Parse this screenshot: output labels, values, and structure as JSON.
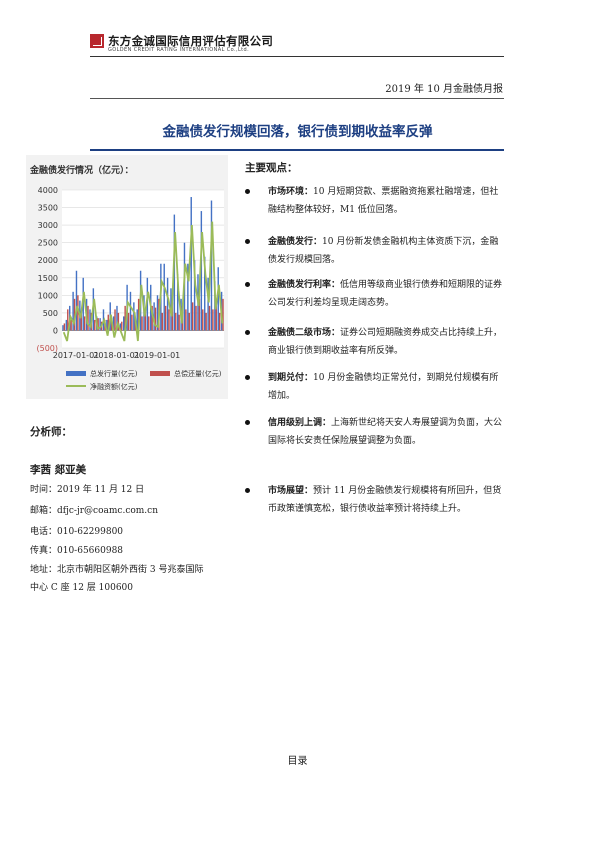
{
  "header": {
    "company_cn": "东方金诚国际信用评估有限公司",
    "company_en": "GOLDEN CREDIT RATING INTERNATIONAL Co.,Ltd.",
    "report_name": "2019 年 10 月金融债月报"
  },
  "title": "金融债发行规模回落，银行债到期收益率反弹",
  "chart_box": {
    "title": "金融债发行情况（亿元）：",
    "chart_data": {
      "type": "bar",
      "ylim": [
        -500,
        4000
      ],
      "yticks": [
        "4000",
        "3500",
        "3000",
        "2500",
        "2000",
        "1500",
        "1000",
        "500",
        "0",
        "(500)"
      ],
      "xticks": [
        "2017-01-01",
        "2018-01-01",
        "2019-01-01"
      ],
      "series": [
        {
          "name": "总发行量(亿元)",
          "type": "bar",
          "color": "#4472c4",
          "values": [
            150,
            300,
            700,
            1100,
            1700,
            850,
            1500,
            900,
            600,
            1200,
            400,
            350,
            600,
            300,
            800,
            400,
            700,
            200,
            400,
            1300,
            1100,
            800,
            600,
            1700,
            1000,
            1500,
            1300,
            800,
            1000,
            1900,
            1900,
            1500,
            1200,
            3300,
            1600,
            900,
            2500,
            1900,
            3800,
            2000,
            1600,
            3400,
            2100,
            1500,
            3700,
            1400,
            1800,
            1100
          ]
        },
        {
          "name": "总偿还量(亿元)",
          "type": "bar",
          "color": "#c0504d",
          "values": [
            200,
            600,
            300,
            900,
            1000,
            500,
            400,
            700,
            500,
            300,
            350,
            250,
            300,
            450,
            350,
            600,
            500,
            250,
            700,
            500,
            450,
            300,
            900,
            400,
            600,
            400,
            700,
            650,
            900,
            500,
            700,
            600,
            800,
            500,
            450,
            700,
            600,
            500,
            800,
            700,
            900,
            600,
            500,
            700,
            600,
            800,
            500,
            900
          ]
        },
        {
          "name": "净融资额(亿元)",
          "type": "line",
          "color": "#9bbb59",
          "values": [
            -50,
            -300,
            400,
            200,
            700,
            350,
            1100,
            200,
            100,
            900,
            50,
            100,
            300,
            -150,
            450,
            -200,
            200,
            -50,
            -300,
            800,
            650,
            500,
            -300,
            1300,
            400,
            1100,
            600,
            150,
            100,
            1400,
            1200,
            900,
            400,
            2800,
            1150,
            200,
            1900,
            1400,
            3000,
            1300,
            700,
            2800,
            1600,
            800,
            3100,
            600,
            1300,
            200
          ]
        }
      ]
    }
  },
  "analysis": {
    "heading": "分析师：",
    "names": "李茜    郯亚美",
    "date": "时间：2019 年 11 月 12 日",
    "email": "邮箱：dfjc-jr@coamc.com.cn",
    "phone": "电话：010-62299800",
    "fax": "传真：010-65660988",
    "address1": "地址：北京市朝阳区朝外西街 3 号兆泰国际",
    "address2": "中心 C 座 12 层   100600"
  },
  "summary": {
    "heading": "主要观点：",
    "items": [
      {
        "label": "市场环境：",
        "text": "10 月短期贷款、票据融资拖累社融增速，但社融结构整体较好，M1 低位回落。"
      },
      {
        "label": "金融债发行：",
        "text": "10 月份新发债金融机构主体资质下沉，金融债发行规模回落。"
      },
      {
        "label": "金融债发行利率：",
        "text": "低信用等级商业银行债券和短期限的证券公司发行利差均呈现走阔态势。"
      },
      {
        "label": "金融债二级市场：",
        "text": "证券公司短期融资券成交占比持续上升，商业银行债到期收益率有所反弹。"
      },
      {
        "label": "到期兑付：",
        "text": "10 月份金融债均正常兑付，到期兑付规模有所增加。"
      },
      {
        "label": "信用级别上调：",
        "text": "上海新世纪将天安人寿展望调为负面，大公国际将长安责任保险展望调整为负面。"
      },
      {
        "label": "市场展望：",
        "text": "预计 11 月份金融债发行规模将有所回升，但货币政策谨慎宽松，银行债收益率预计将持续上升。"
      }
    ]
  },
  "footer": {
    "contents": "目录"
  }
}
